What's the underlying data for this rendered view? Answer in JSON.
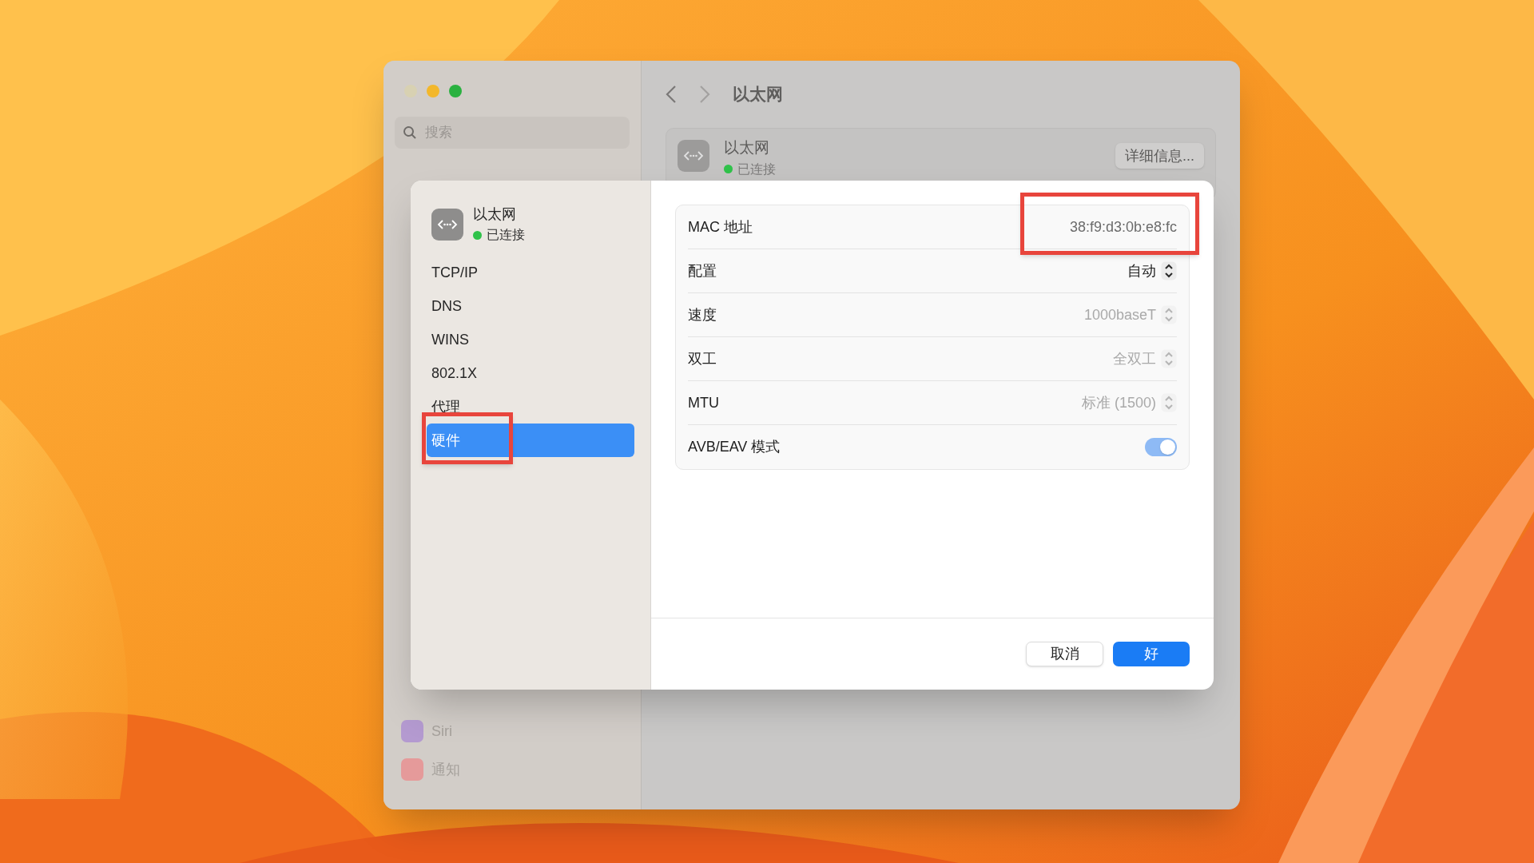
{
  "window": {
    "title": "以太网",
    "search": {
      "placeholder": "搜索"
    },
    "sidebar": {
      "items": [
        {
          "label": "Siri",
          "color": "#b49ad0"
        },
        {
          "label": "通知",
          "color": "#e59a9a"
        }
      ]
    },
    "header": {
      "name": "以太网",
      "status": "已连接",
      "connected": true,
      "details_button": "详细信息..."
    }
  },
  "sheet": {
    "service": {
      "name": "以太网",
      "status": "已连接",
      "connected": true
    },
    "nav": [
      {
        "label": "TCP/IP",
        "selected": false,
        "highlighted": false
      },
      {
        "label": "DNS",
        "selected": false,
        "highlighted": false
      },
      {
        "label": "WINS",
        "selected": false,
        "highlighted": false
      },
      {
        "label": "802.1X",
        "selected": false,
        "highlighted": false
      },
      {
        "label": "代理",
        "selected": false,
        "highlighted": false
      },
      {
        "label": "硬件",
        "selected": true,
        "highlighted": true
      }
    ],
    "rows": [
      {
        "kind": "text",
        "label": "MAC 地址",
        "value": "38:f9:d3:0b:e8:fc",
        "highlighted": true
      },
      {
        "kind": "popup",
        "label": "配置",
        "value": "自动",
        "disabled": false
      },
      {
        "kind": "popup",
        "label": "速度",
        "value": "1000baseT",
        "disabled": true
      },
      {
        "kind": "popup",
        "label": "双工",
        "value": "全双工",
        "disabled": true
      },
      {
        "kind": "popup",
        "label": "MTU",
        "value": "标准 (1500)",
        "disabled": true
      },
      {
        "kind": "toggle",
        "label": "AVB/EAV 模式",
        "on": true,
        "disabled": true
      }
    ],
    "buttons": [
      {
        "label": "取消",
        "kind": "secondary"
      },
      {
        "label": "好",
        "kind": "primary"
      }
    ]
  }
}
